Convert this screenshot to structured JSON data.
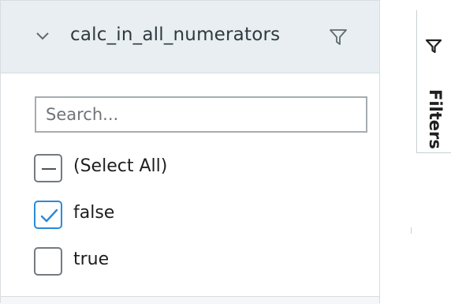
{
  "column_filter": {
    "column_name": "calc_in_all_numerators",
    "search_placeholder": "Search...",
    "search_value": "",
    "options": [
      {
        "label": "(Select All)",
        "state": "indeterminate"
      },
      {
        "label": "false",
        "state": "checked"
      },
      {
        "label": "true",
        "state": "unchecked"
      }
    ]
  },
  "side_panel": {
    "tab_label": "Filters",
    "icon": "filter-icon"
  },
  "colors": {
    "header_bg": "#e8eef1",
    "checkbox_checked": "#2b8ad8",
    "checkbox_border": "#737b80"
  }
}
